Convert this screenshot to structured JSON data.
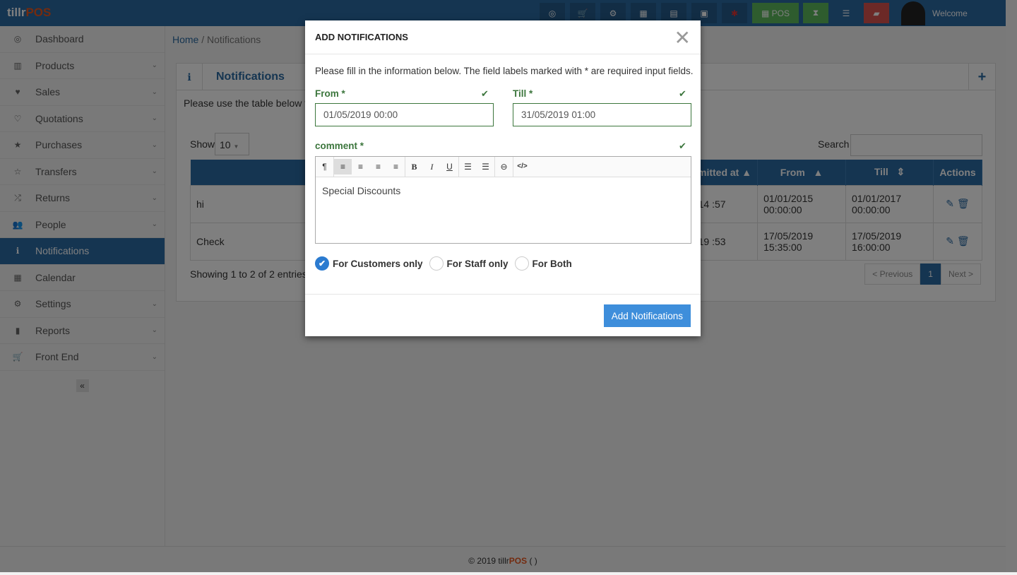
{
  "app": {
    "logo_a": "tillr",
    "logo_b": "POS",
    "welcome": "Welcome",
    "pos_label": "POS"
  },
  "toolbar_icons": [
    "dashboard-icon",
    "cart-icon",
    "cogs-icon",
    "calculator-icon",
    "calendar-icon",
    "html5-icon",
    "flag-uk-icon",
    "pos-button",
    "hourglass-icon",
    "list-icon",
    "eraser-icon"
  ],
  "sidebar": {
    "items": [
      {
        "label": "Dashboard",
        "icon": "◎",
        "chev": false
      },
      {
        "label": "Products",
        "icon": "▥",
        "chev": true
      },
      {
        "label": "Sales",
        "icon": "♥",
        "chev": true
      },
      {
        "label": "Quotations",
        "icon": "♡",
        "chev": true
      },
      {
        "label": "Purchases",
        "icon": "★",
        "chev": true
      },
      {
        "label": "Transfers",
        "icon": "☆",
        "chev": true
      },
      {
        "label": "Returns",
        "icon": "⤮",
        "chev": true
      },
      {
        "label": "People",
        "icon": "👥",
        "chev": true
      },
      {
        "label": "Notifications",
        "icon": "ℹ",
        "chev": false,
        "active": true
      },
      {
        "label": "Calendar",
        "icon": "▦",
        "chev": false
      },
      {
        "label": "Settings",
        "icon": "⚙",
        "chev": true
      },
      {
        "label": "Reports",
        "icon": "▮",
        "chev": true
      },
      {
        "label": "Front End",
        "icon": "🛒",
        "chev": true
      }
    ],
    "collapse": "«"
  },
  "breadcrumb": {
    "home": "Home",
    "current": "Notifications"
  },
  "panel": {
    "title": "Notifications",
    "intro": "Please use the table below to",
    "show_label": "Show",
    "show_value": "10",
    "search_label": "Search",
    "columns": [
      "",
      "omitted at",
      "From",
      "Till",
      "Actions"
    ],
    "rows": [
      {
        "comment": "hi",
        "submitted": "/2014 :57",
        "from": "01/01/2015 00:00:00",
        "till": "01/01/2017 00:00:00"
      },
      {
        "comment": "Check",
        "submitted": "/2019 :53",
        "from": "17/05/2019 15:35:00",
        "till": "17/05/2019 16:00:00"
      }
    ],
    "info": "Showing 1 to 2 of 2 entries",
    "prev": "< Previous",
    "page": "1",
    "next": "Next >"
  },
  "modal": {
    "title": "ADD NOTIFICATIONS",
    "note": "Please fill in the information below. The field labels marked with * are required input fields.",
    "from_label": "From *",
    "from_value": "01/05/2019 00:00",
    "till_label": "Till *",
    "till_value": "31/05/2019 01:00",
    "comment_label": "comment *",
    "comment_value": "Special Discounts",
    "radios": [
      {
        "label": "For Customers only",
        "checked": true
      },
      {
        "label": "For Staff only",
        "checked": false
      },
      {
        "label": "For Both",
        "checked": false
      }
    ],
    "submit": "Add Notifications"
  },
  "footer": {
    "copy": "© 2019 tillr",
    "brand": "POS"
  },
  "colors": {
    "primary": "#2b6aa3",
    "brand_orange": "#e8561f",
    "success": "#3c763d",
    "button": "#3e8edb"
  }
}
